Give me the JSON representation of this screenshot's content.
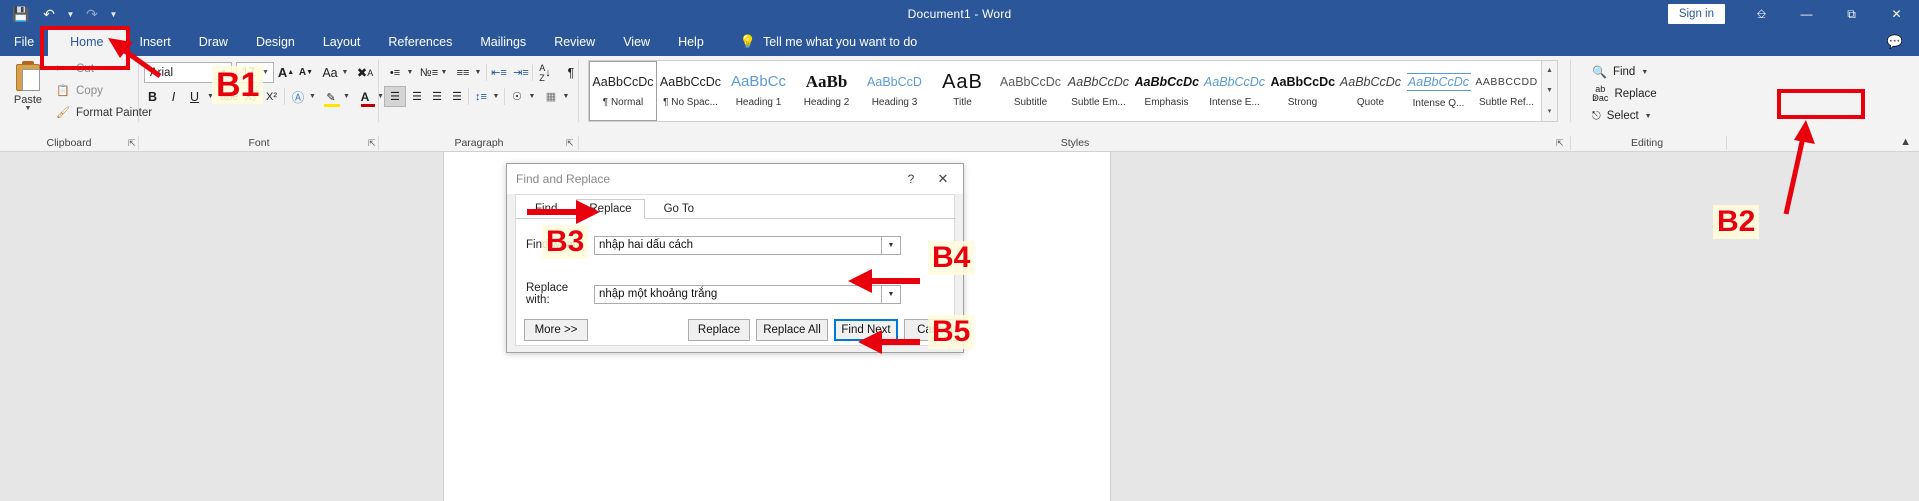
{
  "window": {
    "title": "Document1  -  Word",
    "signin_label": "Sign in",
    "ribbon_display_icon": "ribbon-display-options-icon",
    "minimize_icon": "minimize-icon",
    "restore_icon": "restore-icon",
    "close_icon": "close-icon",
    "comments_icon": "comments-icon"
  },
  "quick_access": {
    "save_icon": "save-icon",
    "undo_icon": "undo-icon",
    "undo_caret": "chevron-down-icon",
    "redo_icon": "redo-icon",
    "customize_icon": "customize-quick-access-toolbar-icon"
  },
  "tabs": [
    {
      "label": "File",
      "active": false
    },
    {
      "label": "Home",
      "active": true
    },
    {
      "label": "Insert",
      "active": false
    },
    {
      "label": "Draw",
      "active": false
    },
    {
      "label": "Design",
      "active": false
    },
    {
      "label": "Layout",
      "active": false
    },
    {
      "label": "References",
      "active": false
    },
    {
      "label": "Mailings",
      "active": false
    },
    {
      "label": "Review",
      "active": false
    },
    {
      "label": "View",
      "active": false
    },
    {
      "label": "Help",
      "active": false
    }
  ],
  "tell_me": {
    "icon": "lightbulb-icon",
    "text": "Tell me what you want to do"
  },
  "ribbon": {
    "collapse_icon": "chevron-up-icon",
    "groups": [
      {
        "name": "Clipboard",
        "label": "Clipboard",
        "has_launcher": true
      },
      {
        "name": "Font",
        "label": "Font",
        "has_launcher": true
      },
      {
        "name": "Paragraph",
        "label": "Paragraph",
        "has_launcher": true
      },
      {
        "name": "Styles",
        "label": "Styles",
        "has_launcher": true
      },
      {
        "name": "Editing",
        "label": "Editing",
        "has_launcher": false
      }
    ],
    "clipboard": {
      "paste_label": "Paste",
      "paste_caret": "chevron-down-icon",
      "cut_label": "Cut",
      "copy_label": "Copy",
      "format_painter_label": "Format Painter"
    },
    "font": {
      "font_name": "Arial",
      "font_size": "17",
      "grow_font": "A",
      "shrink_font": "A",
      "change_case": "Aa",
      "clear_formatting": "clear-formatting-icon",
      "bold": "B",
      "italic": "I",
      "underline": "U",
      "strikethrough": "abc",
      "subscript": "X₂",
      "superscript": "X²",
      "text_effects": "A",
      "highlight": "text-highlight-icon",
      "font_color": "A"
    },
    "paragraph": {
      "bullets": "bullets-icon",
      "numbering": "numbering-icon",
      "multilevel": "multilevel-list-icon",
      "decrease_indent": "decrease-indent-icon",
      "increase_indent": "increase-indent-icon",
      "sort": "sort-icon",
      "show_marks": "¶",
      "align_left": "align-left-icon",
      "align_center": "align-center-icon",
      "align_right": "align-right-icon",
      "justify": "justify-icon",
      "line_spacing": "line-spacing-icon",
      "shading": "shading-icon",
      "borders": "borders-icon"
    },
    "styles": [
      {
        "preview": "AaBbCcDc",
        "label": "¶ Normal",
        "selected": true,
        "style": "normal"
      },
      {
        "preview": "AaBbCcDc",
        "label": "¶ No Spac...",
        "selected": false,
        "style": "normal"
      },
      {
        "preview": "AaBbCc",
        "label": "Heading 1",
        "selected": false,
        "style": "heading1"
      },
      {
        "preview": "AaBb",
        "label": "Heading 2",
        "selected": false,
        "style": "heading2"
      },
      {
        "preview": "AaBbCcD",
        "label": "Heading 3",
        "selected": false,
        "style": "heading3"
      },
      {
        "preview": "AaB",
        "label": "Title",
        "selected": false,
        "style": "title"
      },
      {
        "preview": "AaBbCcDc",
        "label": "Subtitle",
        "selected": false,
        "style": "subtitle"
      },
      {
        "preview": "AaBbCcDc",
        "label": "Subtle Em...",
        "selected": false,
        "style": "subtle-em"
      },
      {
        "preview": "AaBbCcDc",
        "label": "Emphasis",
        "selected": false,
        "style": "emphasis"
      },
      {
        "preview": "AaBbCcDc",
        "label": "Intense E...",
        "selected": false,
        "style": "intense-em"
      },
      {
        "preview": "AaBbCcDc",
        "label": "Strong",
        "selected": false,
        "style": "strong"
      },
      {
        "preview": "AaBbCcDc",
        "label": "Quote",
        "selected": false,
        "style": "quote"
      },
      {
        "preview": "AaBbCcDc",
        "label": "Intense Q...",
        "selected": false,
        "style": "intense-q"
      },
      {
        "preview": "AABBCCDD",
        "label": "Subtle Ref...",
        "selected": false,
        "style": "subtle-ref"
      }
    ],
    "styles_scroll": {
      "up": "scroll-up-icon",
      "down": "scroll-down-icon",
      "more": "more-styles-icon"
    },
    "editing": {
      "find_label": "Find",
      "find_icon": "search-icon",
      "find_caret": "chevron-down-icon",
      "replace_label": "Replace",
      "replace_icon": "replace-icon",
      "select_label": "Select",
      "select_icon": "select-icon",
      "select_caret": "chevron-down-icon"
    }
  },
  "dialog": {
    "title": "Find and Replace",
    "help_icon": "help-icon",
    "close_icon": "close-icon",
    "tabs": [
      {
        "label": "Find",
        "active": false
      },
      {
        "label": "Replace",
        "active": true
      },
      {
        "label": "Go To",
        "active": false
      }
    ],
    "find_what_label": "Find what:",
    "find_what_value": "nhập hai dấu cách",
    "replace_with_label": "Replace with:",
    "replace_with_value": "nhập một khoảng trắng",
    "dropdown_icon": "chevron-down-icon",
    "buttons": [
      {
        "label": "More >>",
        "default": false
      },
      {
        "label": "Replace",
        "default": false
      },
      {
        "label": "Replace All",
        "default": false
      },
      {
        "label": "Find Next",
        "default": true
      },
      {
        "label": "Cancel",
        "default": false
      }
    ]
  },
  "annotations": {
    "color": "#e8000d",
    "steps": [
      {
        "id": "B1",
        "target": "home-tab"
      },
      {
        "id": "B2",
        "target": "replace-button"
      },
      {
        "id": "B3",
        "target": "find-and-replace-dialog"
      },
      {
        "id": "B4",
        "target": "find-what-input"
      },
      {
        "id": "B5",
        "target": "replace-with-input"
      }
    ]
  }
}
